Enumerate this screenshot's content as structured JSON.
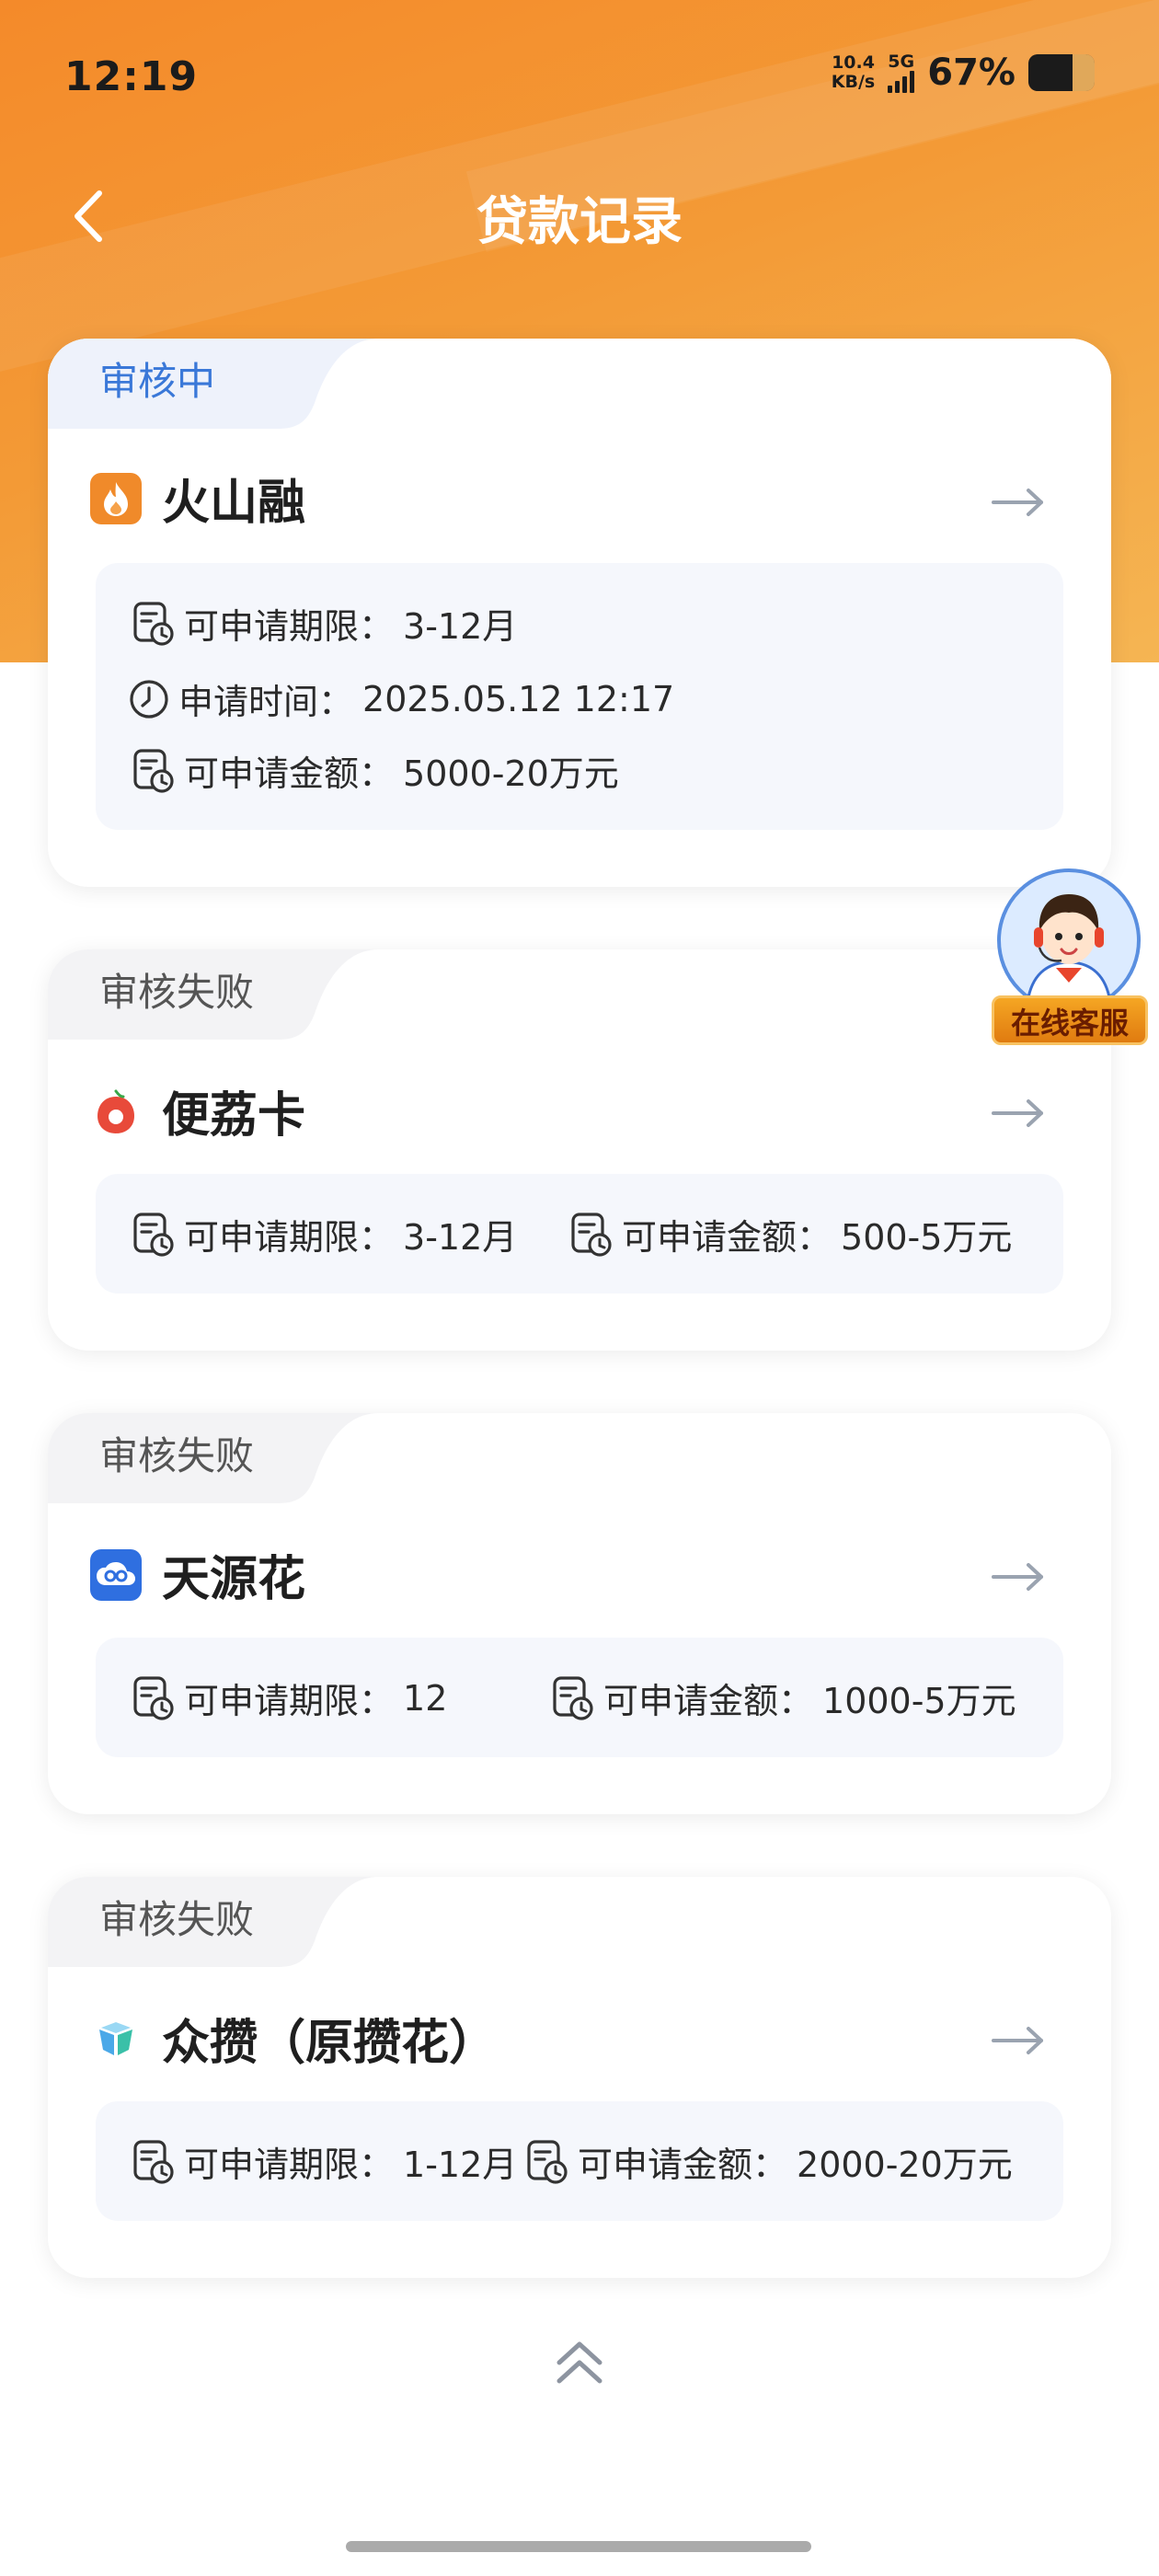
{
  "status_bar": {
    "time": "12:19",
    "net_speed_value": "10.4",
    "net_speed_unit": "KB/s",
    "network": "5G",
    "battery_percent": "67%",
    "battery_level": 0.67
  },
  "header": {
    "title": "贷款记录",
    "back_icon": "chevron-left-icon"
  },
  "floating_service": {
    "label": "在线客服",
    "icon": "customer-service-avatar"
  },
  "records": [
    {
      "status": "审核中",
      "status_color": "#3a78d8",
      "brand": "火山融",
      "logo_icon": "flame-icon",
      "logo_color": "#f08a2a",
      "rows": [
        {
          "label": "可申请期限：",
          "value": "3-12月",
          "icon": "doc-clock-icon"
        },
        {
          "label": "申请时间：",
          "value": "2025.05.12 12:17",
          "icon": "clock-icon"
        },
        {
          "label": "可申请金额：",
          "value": "5000-20万元",
          "icon": "doc-clock-icon"
        }
      ]
    },
    {
      "status": "审核失败",
      "brand": "便荔卡",
      "logo_icon": "lychee-icon",
      "logo_color": "#e84a3a",
      "rows": [
        {
          "label": "可申请期限：",
          "value": "3-12月",
          "icon": "doc-clock-icon"
        },
        {
          "label": "可申请金额：",
          "value": "500-5万元",
          "icon": "doc-clock-icon"
        }
      ]
    },
    {
      "status": "审核失败",
      "brand": "天源花",
      "logo_icon": "cloud-icon",
      "logo_color": "#2f6fe0",
      "rows": [
        {
          "label": "可申请期限：",
          "value": "12",
          "icon": "doc-clock-icon"
        },
        {
          "label": "可申请金额：",
          "value": "1000-5万元",
          "icon": "doc-clock-icon"
        }
      ]
    },
    {
      "status": "审核失败",
      "brand": "众攒（原攒花）",
      "logo_icon": "crystal-icon",
      "logo_color": "#4aa8e8",
      "rows": [
        {
          "label": "可申请期限：",
          "value": "1-12月",
          "icon": "doc-clock-icon"
        },
        {
          "label": "可申请金额：",
          "value": "2000-20万元",
          "icon": "doc-clock-icon"
        }
      ]
    }
  ],
  "footer": {
    "scroll_top_icon": "double-chevron-up-icon"
  }
}
